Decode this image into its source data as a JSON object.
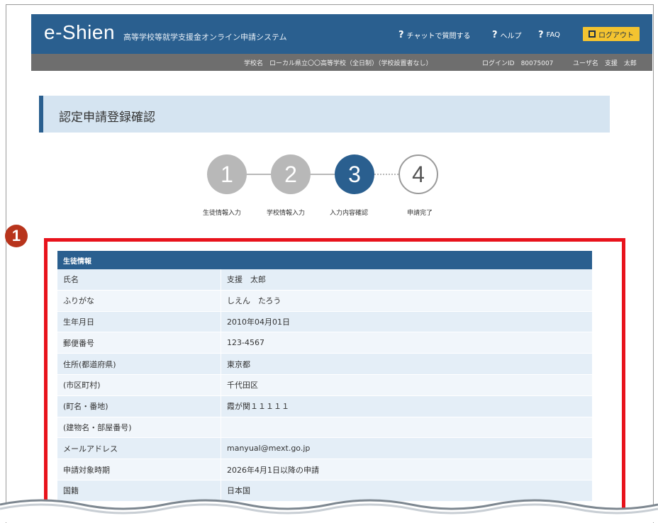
{
  "header": {
    "logo": "e-Shien",
    "system_name": "高等学校等就学支援金オンライン申請システム",
    "nav": [
      {
        "label": "チャットで質問する"
      },
      {
        "label": "ヘルプ"
      },
      {
        "label": "FAQ"
      }
    ],
    "logout_label": "ログアウト"
  },
  "subbar": {
    "school": "学校名　ローカル県立〇〇高等学校（全日制）（学校設置者なし）",
    "login_id": "ログインID　80075007",
    "user": "ユーザ名　支援　太郎"
  },
  "page_title": "認定申請登録確認",
  "steps": [
    {
      "number": "1",
      "label": "生徒情報入力",
      "state": "done"
    },
    {
      "number": "2",
      "label": "学校情報入力",
      "state": "done"
    },
    {
      "number": "3",
      "label": "入力内容確認",
      "state": "current"
    },
    {
      "number": "4",
      "label": "申請完了",
      "state": "pending"
    }
  ],
  "annotation_badge": "1",
  "section": {
    "header": "生徒情報",
    "rows": [
      {
        "label": "氏名",
        "value": "支援　太郎"
      },
      {
        "label": "ふりがな",
        "value": "しえん　たろう"
      },
      {
        "label": "生年月日",
        "value": "2010年04月01日"
      },
      {
        "label": "郵便番号",
        "value": "123-4567"
      },
      {
        "label": "住所(都道府県)",
        "value": "東京都"
      },
      {
        "label": "(市区町村)",
        "value": "千代田区"
      },
      {
        "label": "(町名・番地)",
        "value": "霞が関１１１１１"
      },
      {
        "label": "(建物名・部屋番号)",
        "value": ""
      },
      {
        "label": "メールアドレス",
        "value": "manyual@mext.go.jp"
      },
      {
        "label": "申請対象時期",
        "value": "2026年4月1日以降の申請"
      },
      {
        "label": "国籍",
        "value": "日本国"
      }
    ]
  },
  "colors": {
    "header_bg": "#2a5f8f",
    "subbar_bg": "#6e6e6e",
    "logout_bg": "#f4c430",
    "highlight_border": "#e8131c",
    "badge_bg": "#b8341c"
  }
}
